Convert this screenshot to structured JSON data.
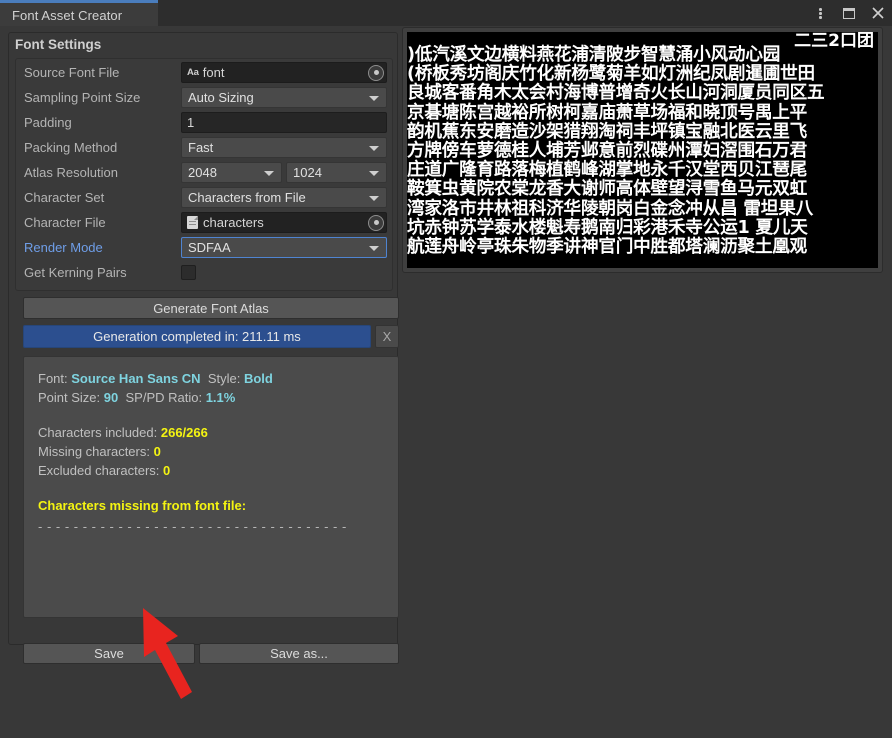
{
  "window": {
    "tab_title": "Font Asset Creator",
    "controls": [
      {
        "name": "more-options",
        "glyph": "kebab"
      },
      {
        "name": "maximize",
        "glyph": "square"
      },
      {
        "name": "close",
        "glyph": "x"
      }
    ]
  },
  "panel": {
    "section_title": "Font Settings",
    "rows": [
      {
        "label": "Source Font File",
        "type": "object",
        "value": "font",
        "icon": "aa-font-icon"
      },
      {
        "label": "Sampling Point Size",
        "type": "dropdown",
        "value": "Auto Sizing"
      },
      {
        "label": "Padding",
        "type": "number",
        "value": "1"
      },
      {
        "label": "Packing Method",
        "type": "dropdown",
        "value": "Fast"
      },
      {
        "label": "Atlas Resolution",
        "type": "dropdown-pair",
        "value": "2048",
        "value2": "1024"
      },
      {
        "label": "Character Set",
        "type": "dropdown",
        "value": "Characters from File"
      },
      {
        "label": "Character File",
        "type": "object",
        "value": "characters",
        "icon": "text-file-icon"
      },
      {
        "label": "Render Mode",
        "type": "dropdown",
        "value": "SDFAA",
        "highlight": true
      },
      {
        "label": "Get Kerning Pairs",
        "type": "checkbox",
        "checked": false
      }
    ],
    "generate_button": "Generate Font Atlas",
    "progress_text": "Generation completed in: 211.11 ms",
    "progress_cancel": "X",
    "save_button": "Save",
    "save_as_button": "Save as..."
  },
  "info": {
    "font_label": "Font:",
    "font_value": "Source Han Sans CN",
    "style_label": "Style:",
    "style_value": "Bold",
    "point_size_label": "Point Size:",
    "point_size_value": "90",
    "ratio_label": "SP/PD Ratio:",
    "ratio_value": "1.1%",
    "included_label": "Characters included:",
    "included_value": "266/266",
    "missing_label": "Missing characters:",
    "missing_value": "0",
    "excluded_label": "Excluded characters:",
    "excluded_value": "0",
    "missing_from_font_heading": "Characters missing from font file:",
    "divider": "- - - - - - - - - - - - - - - - - - - - - - - - - - - - - - - - - - -"
  },
  "atlas": {
    "top_overflow": "二三2口团",
    "rows": [
      ")低汽溪文边横料燕花浦清陂步智慧涌小风动心园",
      "(桥板秀坊阁庆竹化新杨鹭菊羊如灯洲纪凤剧暹圃世田",
      "良城客番角木太会村海博普增奇火长山河洞厦员同区五",
      "京碁塘陈宫越裕所树柯嘉庙萧草场福和晓顶号禺上平",
      "韵机蕉东安磨造沙架猎翔淘祠丰坪镇宝融北医云里飞",
      "方牌傍车萝德桂人埔芳邺意前烈碟州潭妇滘围石万君",
      "庄道广隆育路落梅植鹤峰湖掌地永千汉堂西贝江琶尾",
      "鞍箕虫黄院农棠龙香大谢师高体壁望浔雪鱼马元双虹",
      "湾家洛市井林祖科济华陵朝岗白金念冲从昌 雷坦果八",
      "坑赤钟苏学泰水楼魁寿鹅南归彩港禾寺公运1 夏儿天",
      "航莲舟岭亭珠朱物季讲神官门中胜都塔澜沥聚土凰观"
    ]
  },
  "annotation": {
    "arrow_color": "#e8241f",
    "arrow_target": "save-button"
  }
}
